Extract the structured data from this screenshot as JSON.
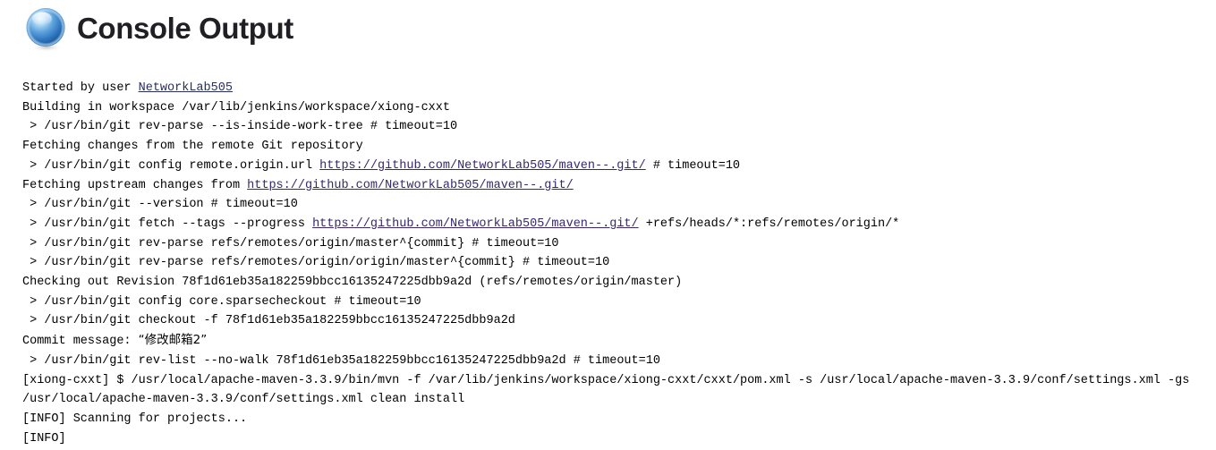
{
  "header": {
    "title": "Console Output",
    "logo_icon": "jenkins-blue-ball-icon",
    "logo_colors": {
      "highlight": "#d8ecfb",
      "mid": "#3f8fd2",
      "dark": "#1c5c9e",
      "rim": "#8fc4ea"
    }
  },
  "console": {
    "link_color": "#36276e",
    "user_link_color": "#262e63",
    "repo_url": "https://github.com/NetworkLab505/maven--.git/",
    "user": "NetworkLab505",
    "commit_hash": "78f1d61eb35a182259bbcc16135247225dbb9a2d",
    "commit_message": "“修改邮箱2”",
    "lines": {
      "l1_pre": "Started by user ",
      "l2": "Building in workspace /var/lib/jenkins/workspace/xiong-cxxt",
      "l3": " > /usr/bin/git rev-parse --is-inside-work-tree # timeout=10",
      "l4": "Fetching changes from the remote Git repository",
      "l5_pre": " > /usr/bin/git config remote.origin.url ",
      "l5_post": " # timeout=10",
      "l6_pre": "Fetching upstream changes from ",
      "l7": " > /usr/bin/git --version # timeout=10",
      "l8_pre": " > /usr/bin/git fetch --tags --progress ",
      "l8_post": " +refs/heads/*:refs/remotes/origin/*",
      "l9": " > /usr/bin/git rev-parse refs/remotes/origin/master^{commit} # timeout=10",
      "l10": " > /usr/bin/git rev-parse refs/remotes/origin/origin/master^{commit} # timeout=10",
      "l11_pre": "Checking out Revision ",
      "l11_post": " (refs/remotes/origin/master)",
      "l12": " > /usr/bin/git config core.sparsecheckout # timeout=10",
      "l13_pre": " > /usr/bin/git checkout -f ",
      "l14_pre": "Commit message: ",
      "l15_pre": " > /usr/bin/git rev-list --no-walk ",
      "l15_post": " # timeout=10",
      "l16": "[xiong-cxxt] $ /usr/local/apache-maven-3.3.9/bin/mvn -f /var/lib/jenkins/workspace/xiong-cxxt/cxxt/pom.xml -s /usr/local/apache-maven-3.3.9/conf/settings.xml -gs",
      "l17": "/usr/local/apache-maven-3.3.9/conf/settings.xml clean install",
      "l18": "[INFO] Scanning for projects...",
      "l19": "[INFO]"
    }
  }
}
